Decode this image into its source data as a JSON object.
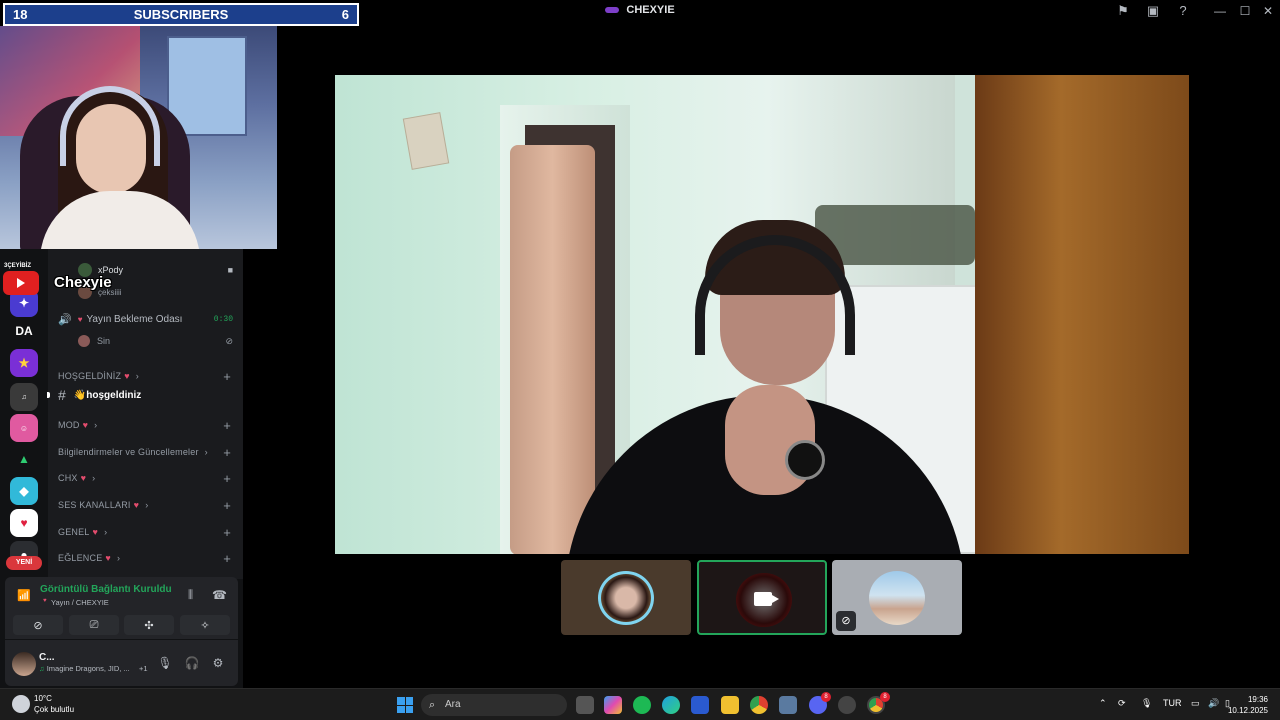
{
  "window": {
    "title": "CHEXYIE"
  },
  "overlay": {
    "sub_left": "18",
    "sub_label": "SUBSCRIBERS",
    "sub_right": "6",
    "stream_name": "Chexyie"
  },
  "guilds": [
    {
      "label": "3ÇEYİBİZ",
      "name": "youtube-server"
    },
    {
      "label": "DA",
      "name": "da-server"
    },
    {
      "label": "",
      "name": "server-yellow"
    },
    {
      "label": "",
      "name": "server-mayone"
    },
    {
      "label": "",
      "name": "server-cayali"
    },
    {
      "label": "",
      "name": "server-green"
    },
    {
      "label": "",
      "name": "server-cyan"
    },
    {
      "label": "",
      "name": "server-heart"
    },
    {
      "label": "YENİ",
      "name": "new-badge"
    }
  ],
  "channels": {
    "voice_users_top": [
      {
        "name": "xPody"
      },
      {
        "name": "çeksiiii"
      }
    ],
    "waiting_room": {
      "label": "Yayın Bekleme Odası",
      "time": "0:30",
      "user": "Sin"
    },
    "categories": [
      {
        "label": "HOŞGELDİNİZ"
      },
      {
        "label": "MOD"
      },
      {
        "label": "Bilgilendirmeler ve Güncellemeler"
      },
      {
        "label": "CHX"
      },
      {
        "label": "SES KANALLARI"
      },
      {
        "label": "GENEL"
      },
      {
        "label": "EĞLENCE"
      }
    ],
    "welcome_channel": "👋hoşgeldiniz"
  },
  "voice_panel": {
    "status": "Görüntülü Bağlantı Kuruldu",
    "sub": "Yayın / CHEXYIE"
  },
  "user_panel": {
    "name": "C...",
    "status": "Imagine Dragons, JID, ...",
    "extra": "+1"
  },
  "taskbar": {
    "weather_temp": "10°C",
    "weather_desc": "Çok bulutlu",
    "search_placeholder": "Ara",
    "lang": "TUR",
    "time": "19:36",
    "date": "10.12.2025",
    "badge_discord": "8",
    "badge_chrome": "8"
  }
}
